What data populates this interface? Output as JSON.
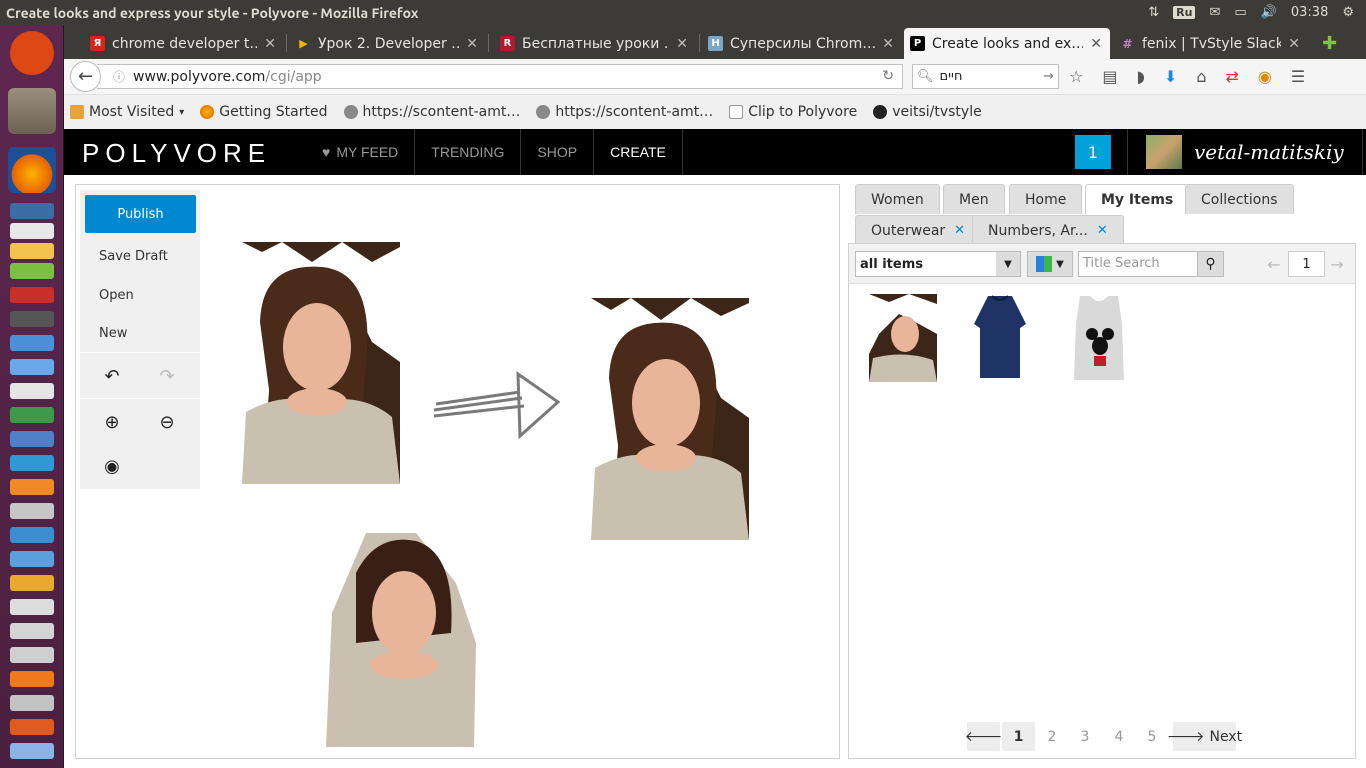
{
  "os": {
    "window_title": "Create looks and express your style - Polyvore - Mozilla Firefox",
    "keyboard_layout": "Ru",
    "clock": "03:38"
  },
  "browser": {
    "tabs": [
      {
        "label": "chrome developer t…",
        "favicon_color": "#d7251b"
      },
      {
        "label": "Урок 2. Developer …",
        "favicon_color": "#f5b400"
      },
      {
        "label": "Бесплатные уроки …",
        "favicon_color": "#b0192f"
      },
      {
        "label": "Суперсилы Chrom…",
        "favicon_color": "#7aa7c7"
      },
      {
        "label": "Create looks and ex…",
        "favicon_color": "#000000"
      },
      {
        "label": "fenix | TvStyle Slack",
        "favicon_color": "#6c3a6a"
      }
    ],
    "url_host": "www.polyvore.com",
    "url_path": "/cgi/app",
    "search_value": "חיים",
    "bookmarks": [
      {
        "label": "Most Visited",
        "icon": "folder-icon"
      },
      {
        "label": "Getting Started",
        "icon": "firefox-icon"
      },
      {
        "label": "https://scontent-amt…",
        "icon": "globe-icon"
      },
      {
        "label": "https://scontent-amt…",
        "icon": "globe-icon"
      },
      {
        "label": "Clip to Polyvore",
        "icon": "page-icon"
      },
      {
        "label": "veitsi/tvstyle",
        "icon": "github-icon"
      }
    ]
  },
  "polyvore": {
    "logo": "POLYVORE",
    "nav": [
      "MY FEED",
      "TRENDING",
      "SHOP",
      "CREATE"
    ],
    "notifications": "1",
    "username": "vetal-matitskiy"
  },
  "editor": {
    "publish": "Publish",
    "save_draft": "Save Draft",
    "open": "Open",
    "new": "New"
  },
  "panel": {
    "tabs": [
      "Women",
      "Men",
      "Home",
      "My Items",
      "Collections"
    ],
    "filter_tabs": [
      "Outerwear",
      "Numbers, Ar..."
    ],
    "filter_select": "all items",
    "title_search_placeholder": "Title Search",
    "page": "1",
    "pager": [
      "1",
      "2",
      "3",
      "4",
      "5"
    ],
    "next": "Next"
  }
}
